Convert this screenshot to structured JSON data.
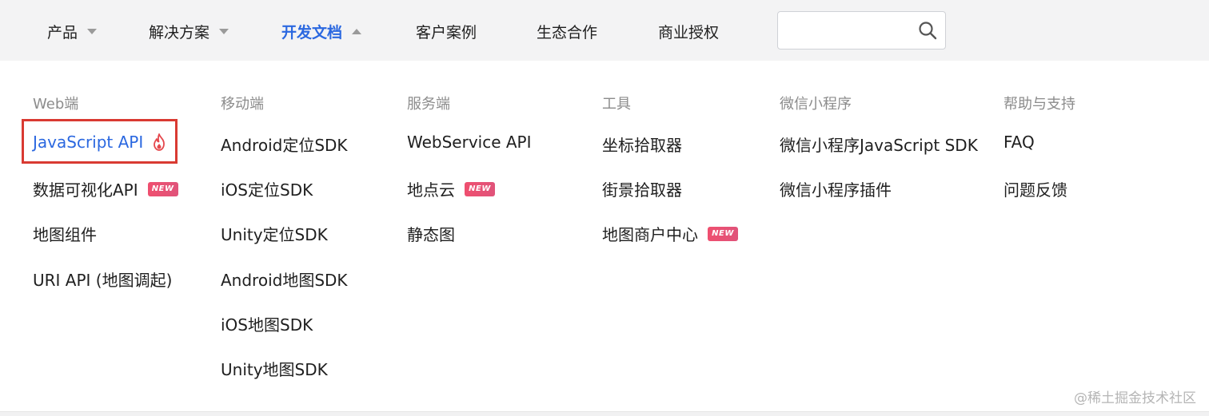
{
  "nav": {
    "items": [
      {
        "label": "产品",
        "caret": "down"
      },
      {
        "label": "解决方案",
        "caret": "down"
      },
      {
        "label": "开发文档",
        "caret": "up",
        "active": true
      },
      {
        "label": "客户案例"
      },
      {
        "label": "生态合作"
      },
      {
        "label": "商业授权"
      }
    ],
    "search": {
      "placeholder": "",
      "value": ""
    }
  },
  "menu": {
    "columns": [
      {
        "title": "Web端",
        "links": [
          {
            "label": "JavaScript API",
            "hot": true,
            "highlighted": true
          },
          {
            "label": "数据可视化API",
            "badge": "NEW"
          },
          {
            "label": "地图组件"
          },
          {
            "label": "URI API (地图调起)"
          }
        ]
      },
      {
        "title": "移动端",
        "links": [
          {
            "label": "Android定位SDK"
          },
          {
            "label": "iOS定位SDK"
          },
          {
            "label": "Unity定位SDK"
          },
          {
            "label": "Android地图SDK"
          },
          {
            "label": "iOS地图SDK"
          },
          {
            "label": "Unity地图SDK"
          }
        ]
      },
      {
        "title": "服务端",
        "links": [
          {
            "label": "WebService API"
          },
          {
            "label": "地点云",
            "badge": "NEW"
          },
          {
            "label": "静态图"
          }
        ]
      },
      {
        "title": "工具",
        "links": [
          {
            "label": "坐标拾取器"
          },
          {
            "label": "街景拾取器"
          },
          {
            "label": "地图商户中心",
            "badge": "NEW"
          }
        ]
      },
      {
        "title": "微信小程序",
        "links": [
          {
            "label": "微信小程序JavaScript SDK"
          },
          {
            "label": "微信小程序插件"
          }
        ]
      },
      {
        "title": "帮助与支持",
        "links": [
          {
            "label": "FAQ"
          },
          {
            "label": "问题反馈"
          }
        ]
      }
    ]
  },
  "watermark": "@稀土掘金技术社区",
  "colors": {
    "accent": "#2b68e0",
    "badge": "#e8506f",
    "highlight_border": "#d93a32"
  }
}
